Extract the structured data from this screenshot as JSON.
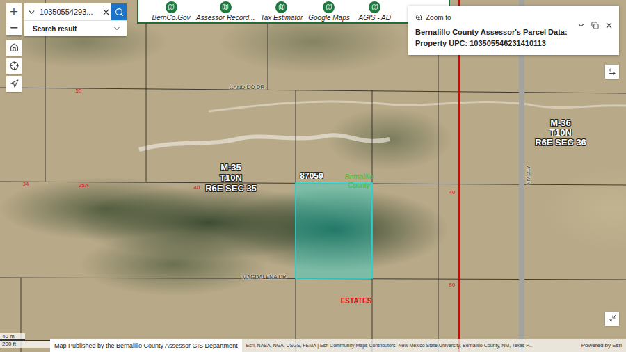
{
  "search": {
    "value": "10350554293...",
    "result_label": "Search result"
  },
  "map_controls": {
    "zoom_in": "+",
    "zoom_out": "−"
  },
  "toolbar": [
    {
      "label": "BernCo.Gov"
    },
    {
      "label": "Assessor Record..."
    },
    {
      "label": "Tax Estimator"
    },
    {
      "label": "Google Maps"
    },
    {
      "label": "AGIS - AD"
    }
  ],
  "popup": {
    "action": "Zoom to",
    "title": "Bernalillo County Assessor's Parcel Data:",
    "subtitle": "Property UPC: 103505546231410113"
  },
  "map": {
    "parcel": {
      "label": "87059",
      "selected": true
    },
    "labels": [
      {
        "text": "CANDIDO DR",
        "kind": "road"
      },
      {
        "text": "M-35",
        "kind": "section"
      },
      {
        "text": "T10N",
        "kind": "section"
      },
      {
        "text": "R6E SEC 35",
        "kind": "section"
      },
      {
        "text": "Bernalillo County",
        "kind": "county"
      },
      {
        "text": "MAGDALENA DR",
        "kind": "road"
      },
      {
        "text": "ESTATES",
        "kind": "subdivision"
      },
      {
        "text": "M-36",
        "kind": "section"
      },
      {
        "text": "T10N",
        "kind": "section"
      },
      {
        "text": "R6E SEC 36",
        "kind": "section"
      },
      {
        "text": "NM 217",
        "kind": "highway"
      },
      {
        "text": "50",
        "kind": "lot"
      },
      {
        "text": "34",
        "kind": "lot"
      },
      {
        "text": "35A",
        "kind": "lot"
      },
      {
        "text": "40",
        "kind": "lot"
      },
      {
        "text": "40",
        "kind": "lot"
      },
      {
        "text": "50",
        "kind": "lot"
      }
    ]
  },
  "scale": {
    "metric": "40 m",
    "imperial": "200 ft"
  },
  "attribution": {
    "publisher": "Map Published by the Bernalillo County Assessor GIS Department",
    "sources": "Esri, NASA, NGA, USGS, FEMA | Esri Community Maps Contributors, New Mexico State University, Bernalillo County, NM, Texas P...",
    "powered_by": "Powered by Esri"
  }
}
